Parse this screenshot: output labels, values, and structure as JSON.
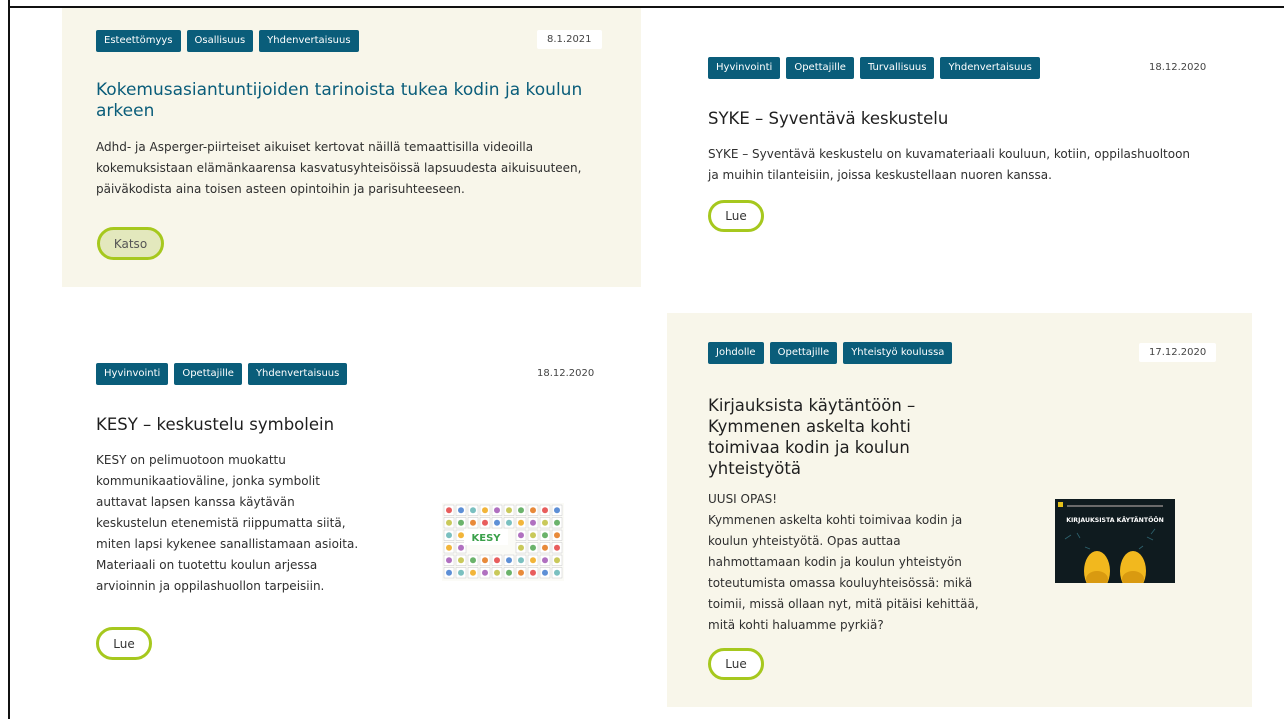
{
  "cards": [
    {
      "tags": [
        "Esteettömyys",
        "Osallisuus",
        "Yhdenvertaisuus"
      ],
      "date": "8.1.2021",
      "title": "Kokemusasiantuntijoiden tarinoista tukea kodin ja koulun arkeen",
      "description": "Adhd- ja Asperger-piirteiset aikuiset kertovat näillä temaattisilla videoilla kokemuksistaan elämänkaarensa kasvatusyhteisöissä lapsuudesta aikuisuuteen, päiväkodista aina toisen asteen opintoihin ja parisuhteeseen.",
      "button": "Katso"
    },
    {
      "tags": [
        "Hyvinvointi",
        "Opettajille",
        "Turvallisuus",
        "Yhdenvertaisuus"
      ],
      "date": "18.12.2020",
      "title": "SYKE – Syventävä keskustelu",
      "description": "SYKE – Syventävä keskustelu on kuvamateriaali kouluun, kotiin, oppilashuoltoon ja muihin tilanteisiin, joissa keskustellaan nuoren kanssa.",
      "button": "Lue"
    },
    {
      "tags": [
        "Hyvinvointi",
        "Opettajille",
        "Yhdenvertaisuus"
      ],
      "date": "18.12.2020",
      "title": "KESY – keskustelu symbolein",
      "description": "KESY on pelimuotoon muokattu kommunikaatioväline, jonka symbolit auttavat lapsen kanssa käytävän keskustelun etenemistä riippumatta siitä, miten lapsi kykenee sanallistamaan asioita. Materiaali on tuotettu koulun arjessa arvioinnin ja oppilashuollon tarpeisiin.",
      "button": "Lue",
      "thumb_text": "KESY"
    },
    {
      "tags": [
        "Johdolle",
        "Opettajille",
        "Yhteistyö koulussa"
      ],
      "date": "17.12.2020",
      "title": "Kirjauksista käytäntöön – Kymmenen askelta kohti toimivaa kodin ja koulun yhteistyötä",
      "description_lead": "UUSI OPAS!",
      "description": "Kymmenen askelta kohti toimivaa kodin ja koulun yhteistyötä. Opas auttaa hahmottamaan kodin ja koulun yhteistyön toteutumista omassa kouluyhteisössä: mikä toimii, missä ollaan nyt, mitä pitäisi kehittää, mitä kohti haluamme pyrkiä?",
      "button": "Lue",
      "thumb_text": "KIRJAUKSISTA KÄYTÄNTÖÖN"
    }
  ],
  "colors": {
    "tag_bg": "#0a5d7a",
    "link_title": "#0a5d7a",
    "button_border": "#a6c81e",
    "card_bg": "#f8f6ea"
  }
}
